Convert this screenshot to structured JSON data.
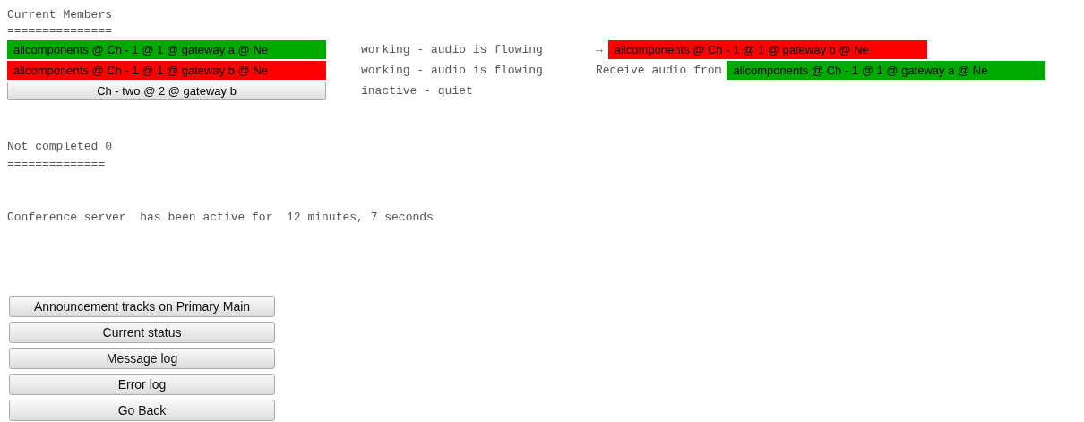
{
  "members_heading": "Current Members",
  "members_rule": "===============",
  "members": [
    {
      "label": "allcomponents @ Ch - 1 @ 1 @ gateway a @ Ne",
      "color": "#00aa00",
      "status": "working - audio is flowing",
      "link": {
        "prefix": "→",
        "target": {
          "label": "allcomponents @ Ch - 1 @ 1 @ gateway b @ Ne",
          "color": "#ff0000"
        }
      }
    },
    {
      "label": "allcomponents @ Ch - 1 @ 1 @ gateway b @ Ne",
      "color": "#ff0000",
      "status": "working - audio is flowing",
      "link": {
        "prefix": "Receive audio from",
        "target": {
          "label": "allcomponents @ Ch - 1 @ 1 @ gateway a @ Ne",
          "color": "#00aa00"
        }
      }
    },
    {
      "label": "Ch - two @ 2 @ gateway b",
      "status": "inactive - quiet"
    }
  ],
  "not_completed": "Not completed 0",
  "not_completed_rule": "==============",
  "uptime": "Conference server  has been active for  12 minutes, 7 seconds",
  "buttons": [
    "Announcement tracks on  Primary Main",
    "Current status",
    "Message log",
    "Error log",
    "Go Back"
  ]
}
